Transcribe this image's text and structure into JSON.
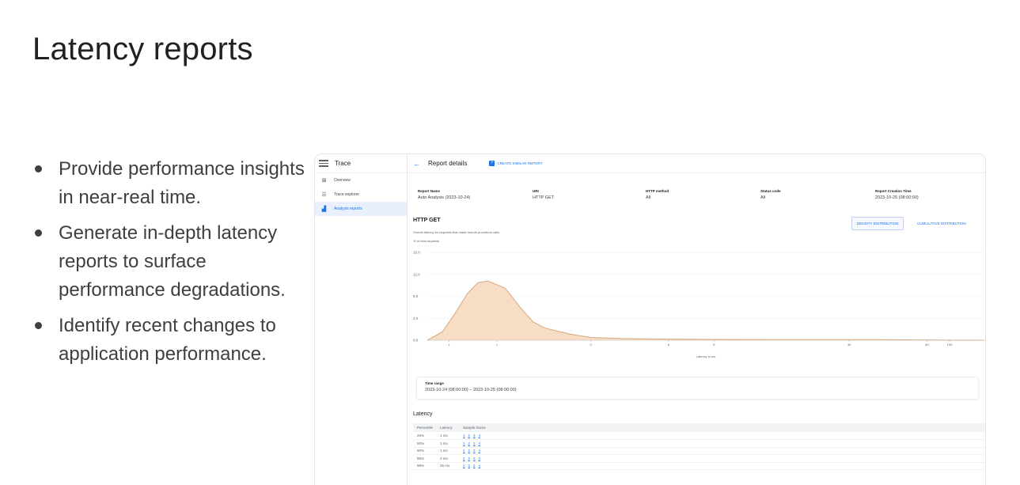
{
  "slide": {
    "title": "Latency reports",
    "bullets": [
      "Provide performance insights in near-real time.",
      "Generate in-depth latency reports to surface performance degradations.",
      "Identify recent changes to application performance."
    ]
  },
  "app": {
    "name": "Trace",
    "nav": [
      {
        "label": "Overview",
        "icon": "overview-icon"
      },
      {
        "label": "Trace explorer",
        "icon": "list-icon"
      },
      {
        "label": "Analysis reports",
        "icon": "chart-icon",
        "active": true
      }
    ],
    "page_title": "Report details",
    "create_button": "CREATE SIMILAR REPORT",
    "meta": [
      {
        "key": "Report Name",
        "value": "Auto Analysis (2023-10-24)"
      },
      {
        "key": "URI",
        "value": "HTTP GET"
      },
      {
        "key": "HTTP method",
        "value": "All"
      },
      {
        "key": "Status code",
        "value": "All"
      },
      {
        "key": "Report Creation Time",
        "value": "2023-10-25 (08:00:00)"
      }
    ],
    "section_title": "HTTP GET",
    "section_desc": "Overall latency for requests that make remote procedure calls",
    "section_sub": "% of total requests",
    "toggle_density": "DENSITY DISTRIBUTION",
    "toggle_cumulative": "CUMULATIVE DISTRIBUTION",
    "time_range_label": "Time range",
    "time_range_value": "2023-10-24 (08:00:00) – 2023-10-25 (08:00:00)",
    "latency_title": "Latency",
    "table_headers": [
      "Percentile",
      "Latency",
      "Sample traces"
    ],
    "table_rows": [
      {
        "percentile": "25%",
        "latency": "1 ms",
        "traces": [
          "1",
          "2",
          "3",
          "4"
        ]
      },
      {
        "percentile": "50%",
        "latency": "1 ms",
        "traces": [
          "1",
          "2",
          "3",
          "4"
        ]
      },
      {
        "percentile": "90%",
        "latency": "1 ms",
        "traces": [
          "1",
          "2",
          "3",
          "4"
        ]
      },
      {
        "percentile": "95%",
        "latency": "2 ms",
        "traces": [
          "1",
          "2",
          "3",
          "4"
        ]
      },
      {
        "percentile": "99%",
        "latency": "26 ms",
        "traces": [
          "1",
          "2",
          "3",
          "4"
        ]
      }
    ],
    "colors": {
      "accent": "#1a73e8",
      "curve": "#d9a77a",
      "fill": "#f7ddc6"
    }
  },
  "chart_data": {
    "type": "area",
    "xlabel": "Latency in ms",
    "ylabel": "% of total requests",
    "ylim": [
      0,
      16
    ],
    "y_ticks": [
      "16.0",
      "12.0",
      "8.0",
      "4.0",
      "0.0"
    ],
    "x_ticks": [
      "1",
      "1",
      "3",
      "6",
      "9",
      "30",
      "60",
      "100"
    ],
    "grid": true,
    "x": [
      0.7,
      0.8,
      0.9,
      1.0,
      1.1,
      1.2,
      1.4,
      1.6,
      1.8,
      2.0,
      2.5,
      3,
      4,
      6,
      9,
      15,
      20,
      30,
      40,
      60,
      100
    ],
    "values": [
      0.0,
      1.5,
      5.0,
      8.5,
      10.5,
      10.8,
      9.5,
      6.0,
      3.3,
      2.2,
      1.1,
      0.5,
      0.3,
      0.2,
      0.15,
      0.1,
      0.1,
      0.1,
      0.1,
      0.05,
      0.0
    ]
  }
}
